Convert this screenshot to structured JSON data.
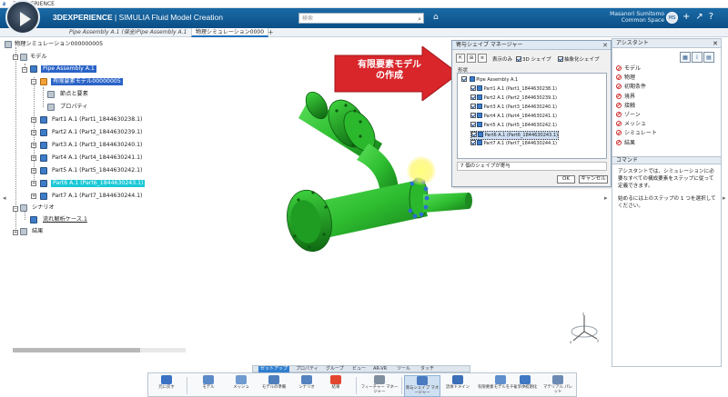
{
  "window": {
    "title": "3DEXPERIENCE"
  },
  "header": {
    "brand_prefix": "3DEXPERIENCE",
    "brand_suffix": " | SIMULIA Fluid Model Creation",
    "search_placeholder": "検索",
    "user_name": "Masanori Sumitomo",
    "user_context": "Common Space",
    "avatar_initials": "MS",
    "accent_color": "#0b4f86"
  },
  "tabs": [
    {
      "label": "Pipe Assembly A.1 (保全)"
    },
    {
      "label": "Pipe Assembly A.1"
    },
    {
      "label": "物理シミュレーション0000"
    }
  ],
  "tree": {
    "root": "物理シミュレーション000000005",
    "model": "モデル",
    "pipe_assembly": "Pipe Assembly A.1",
    "fem": "有限要素モデル00000005",
    "nodes_elements": "節点と要素",
    "properties": "プロパティ",
    "parts": [
      "Part1 A.1 (Part1_1844630238.1)",
      "Part2 A.1 (Part2_1844630239.1)",
      "Part3 A.1 (Part3_1844630240.1)",
      "Part4 A.1 (Part4_1844630241.1)",
      "Part5 A.1 (Part5_1844630242.1)",
      "Part6 A.1 (Part6_1844630243.1)",
      "Part7 A.1 (Part7_1844630244.1)"
    ],
    "scenario": "シナリオ",
    "flow_case": "流れ解析ケース.1",
    "results": "結果"
  },
  "callout": {
    "line1": "有限要素モデル",
    "line2": "の作成",
    "color": "#d8262b"
  },
  "dialog": {
    "title": "寄与シェイプ マネージャー",
    "show_all": "表示のみ",
    "opt_3d": "3D シェイプ",
    "opt_abstract": "抽象化シェイプ",
    "shape_label": "形状",
    "root_item": "Pipe Assembly A.1",
    "items": [
      "Part1 A.1 (Part1_1844630238.1)",
      "Part2 A.1 (Part2_1844630239.1)",
      "Part3 A.1 (Part3_1844630240.1)",
      "Part4 A.1 (Part4_1844630241.1)",
      "Part5 A.1 (Part5_1844630242.1)",
      "Part6 A.1 (Part6_1844630243.1)",
      "Part7 A.1 (Part7_1844630244.1)"
    ],
    "status": "7 個のシェイプが寄与",
    "ok": "OK",
    "cancel": "キャンセル"
  },
  "assistant": {
    "title": "アシスタント",
    "steps": [
      "モデル",
      "物理",
      "初期条件",
      "境界",
      "接触",
      "ゾーン",
      "メッシュ",
      "シミュレート",
      "結果"
    ],
    "command_title": "コマンド",
    "command_text_1": "アシスタントでは、シミュレーションに必要なすべての構成要素をステップに従って定義できます。",
    "command_text_2": "始めるには上のステップの 1 つを選択してください。"
  },
  "action_tabs": [
    "セットアップ",
    "プロパティ",
    "グループ",
    "ビュー",
    "AR-VR",
    "ツール",
    "タッチ"
  ],
  "action_buttons": [
    {
      "label": "元に戻す",
      "color": "#3b72c4"
    },
    {
      "label": "モデル",
      "color": "#5a8ac8"
    },
    {
      "label": "メッシュ",
      "color": "#6f9bd0"
    },
    {
      "label": "モデルの準備",
      "color": "#4e7fbc"
    },
    {
      "label": "シナリオ",
      "color": "#5582c0"
    },
    {
      "label": "結果",
      "color": "#e2462f"
    },
    {
      "label": "フィーチャー マネージャー",
      "color": "#7f8fa0"
    },
    {
      "label": "寄与シェイプ マネージャー",
      "color": "#4a7ac0"
    },
    {
      "label": "流体ドメイン",
      "color": "#3b6fb8"
    },
    {
      "label": "有限要素モデルをチェック",
      "color": "#5f8fcc"
    },
    {
      "label": "モデル初期化",
      "color": "#3f79c3"
    },
    {
      "label": "マテリアル パレット",
      "color": "#6b8bb4"
    }
  ]
}
